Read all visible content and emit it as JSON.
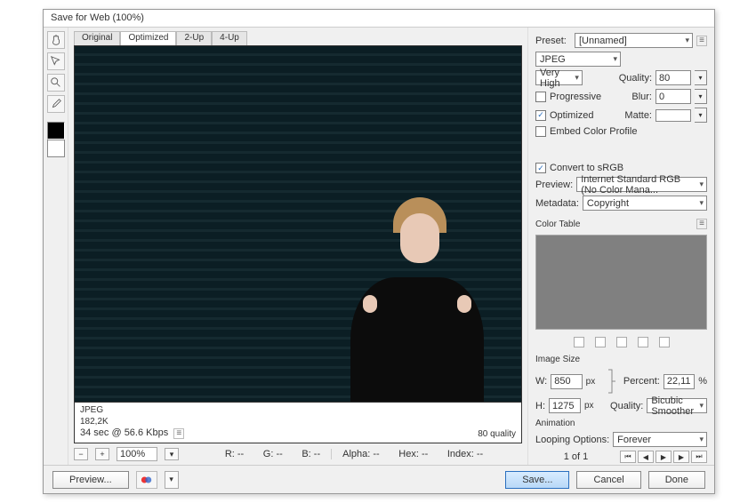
{
  "title": "Save for Web (100%)",
  "tabs": {
    "t0": "Original",
    "t1": "Optimized",
    "t2": "2-Up",
    "t3": "4-Up"
  },
  "preview_info": {
    "format": "JPEG",
    "size": "182,2K",
    "time": "34 sec @ 56.6 Kbps",
    "quality": "80 quality"
  },
  "zoom": "100%",
  "readouts": {
    "r": "R: --",
    "g": "G: --",
    "b": "B: --",
    "alpha": "Alpha: --",
    "hex": "Hex: --",
    "index": "Index: --"
  },
  "preset_label": "Preset:",
  "preset_value": "[Unnamed]",
  "format_value": "JPEG",
  "quality_label": "Quality:",
  "quality_value": "80",
  "quality_preset": "Very High",
  "blur_label": "Blur:",
  "blur_value": "0",
  "matte_label": "Matte:",
  "chk_progressive": "Progressive",
  "chk_optimized": "Optimized",
  "chk_embed": "Embed Color Profile",
  "chk_srgb": "Convert to sRGB",
  "preview_row": "Preview:",
  "preview_value": "Internet Standard RGB (No Color Mana...",
  "metadata_label": "Metadata:",
  "metadata_value": "Copyright",
  "colortable_label": "Color Table",
  "imagesize_label": "Image Size",
  "w_label": "W:",
  "w_value": "850",
  "px": "px",
  "h_label": "H:",
  "h_value": "1275",
  "percent_label": "Percent:",
  "percent_value": "22,11",
  "percent_sym": "%",
  "isq_label": "Quality:",
  "isq_value": "Bicubic Smoother",
  "anim_label": "Animation",
  "loop_label": "Looping Options:",
  "loop_value": "Forever",
  "counter": "1 of 1",
  "btn_preview": "Preview...",
  "btn_save": "Save...",
  "btn_cancel": "Cancel",
  "btn_done": "Done",
  "hamburger": "≡"
}
